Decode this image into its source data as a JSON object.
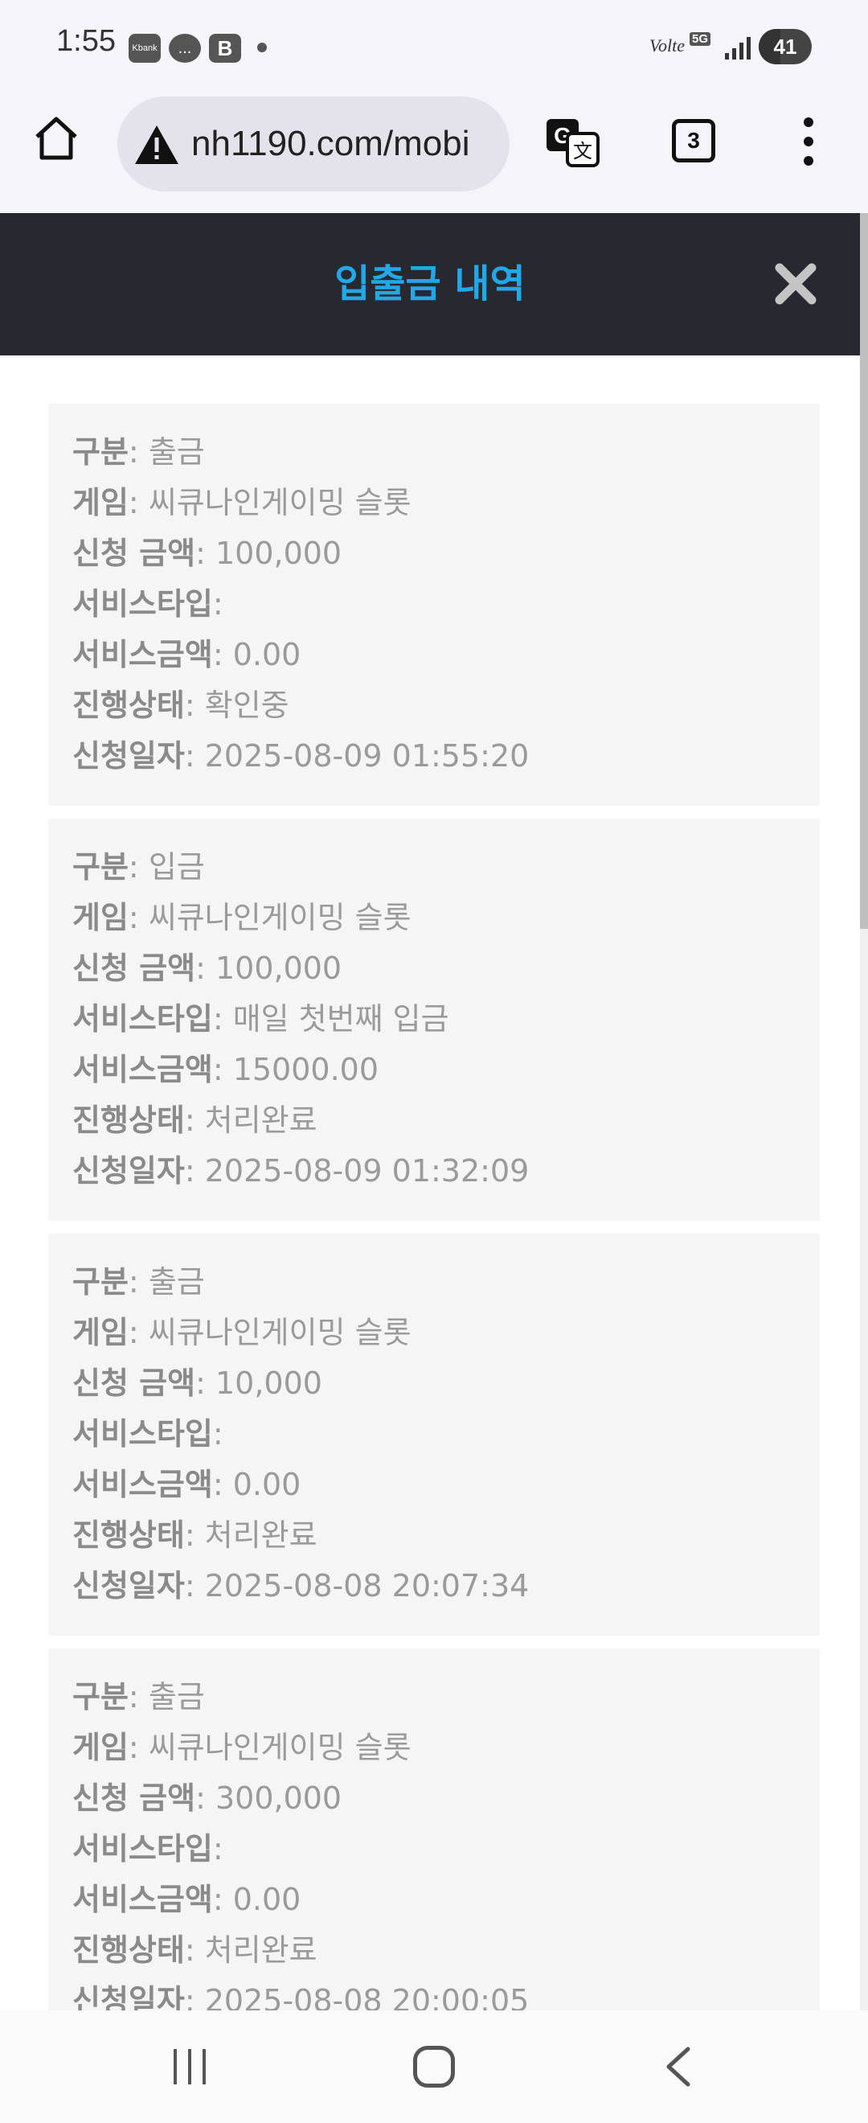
{
  "status_bar": {
    "time": "1:55",
    "app_icons": [
      "Kbank",
      "...",
      "B"
    ],
    "volte": "Volte",
    "network": "5G",
    "battery_level": "41",
    "battery_fraction": 0.41
  },
  "browser": {
    "url": "nh1190.com/mobi",
    "tab_count": "3"
  },
  "header": {
    "title": "입출금 내역"
  },
  "labels": {
    "type": "구분",
    "game": "게임",
    "amount": "신청 금액",
    "service_type": "서비스타입",
    "service_amount": "서비스금액",
    "status": "진행상태",
    "date": "신청일자"
  },
  "transactions": [
    {
      "type": "출금",
      "game": "씨큐나인게이밍 슬롯",
      "amount": "100,000",
      "service_type": "",
      "service_amount": "0.00",
      "status": "확인중",
      "date": "2025-08-09 01:55:20"
    },
    {
      "type": "입금",
      "game": "씨큐나인게이밍 슬롯",
      "amount": "100,000",
      "service_type": "매일 첫번째 입금",
      "service_amount": "15000.00",
      "status": "처리완료",
      "date": "2025-08-09 01:32:09"
    },
    {
      "type": "출금",
      "game": "씨큐나인게이밍 슬롯",
      "amount": "10,000",
      "service_type": "",
      "service_amount": "0.00",
      "status": "처리완료",
      "date": "2025-08-08 20:07:34"
    },
    {
      "type": "출금",
      "game": "씨큐나인게이밍 슬롯",
      "amount": "300,000",
      "service_type": "",
      "service_amount": "0.00",
      "status": "처리완료",
      "date": "2025-08-08 20:00:05"
    }
  ]
}
